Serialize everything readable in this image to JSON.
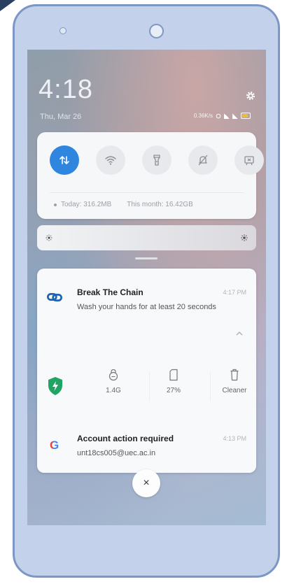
{
  "status_bar": {
    "time": "4:18",
    "date": "Thu, Mar 26",
    "speed": "0.36K/s",
    "icons": [
      "alarm-icon",
      "signal-icon",
      "signal-icon",
      "battery-icon"
    ]
  },
  "quick_settings": {
    "tiles": [
      {
        "name": "mobile-data-icon",
        "active": true
      },
      {
        "name": "wifi-icon",
        "active": false
      },
      {
        "name": "flashlight-icon",
        "active": false
      },
      {
        "name": "silent-icon",
        "active": false
      },
      {
        "name": "screenshot-icon",
        "active": false
      }
    ],
    "usage_today": "Today: 316.2MB",
    "usage_month": "This month: 16.42GB"
  },
  "notifications": {
    "chain": {
      "title": "Break The Chain",
      "time": "4:17 PM",
      "body": "Wash your hands for at least 20 seconds"
    },
    "security": {
      "stats": [
        {
          "icon": "memory-icon",
          "label": "1.4G"
        },
        {
          "icon": "storage-icon",
          "label": "27%"
        },
        {
          "icon": "trash-icon",
          "label": "Cleaner"
        }
      ]
    },
    "google": {
      "logo": "G",
      "title": "Account action required",
      "time": "4:13 PM",
      "body": "unt18cs005@uec.ac.in"
    }
  },
  "clear_button": "×",
  "colors": {
    "accent": "#2e86de",
    "phone_frame": "#c3d1eb",
    "shield": "#1fa463",
    "google_blue": "#4285f4"
  }
}
